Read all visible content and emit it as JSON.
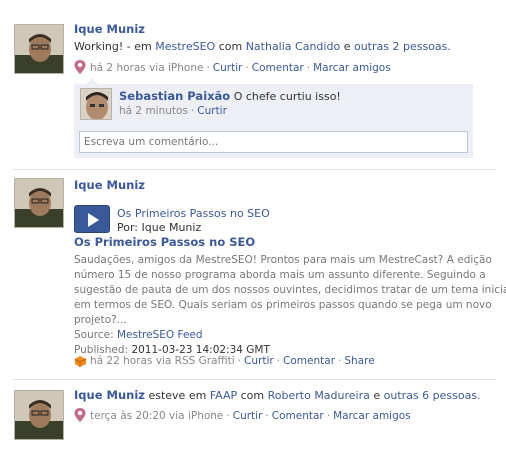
{
  "posts": [
    {
      "author": "Ique Muniz",
      "status_text": "Working!",
      "place_prefix": "- em",
      "place": "MestreSEO",
      "with_prefix": "com",
      "with_person": "Nathalia Candido",
      "and_text": "e",
      "others_link": "outras 2 pessoas.",
      "meta_time": "há 2 horas via iPhone",
      "action_like": "Curtir",
      "action_comment": "Comentar",
      "action_tag": "Marcar amigos",
      "comment": {
        "author": "Sebastian Paixão",
        "text": "O chefe curtiu isso!",
        "time": "há 2 minutos",
        "like": "Curtir"
      },
      "comment_placeholder": "Escreva um comentário..."
    },
    {
      "author": "Ique Muniz",
      "attachment_title": "Os Primeiros Passos no SEO",
      "attachment_by": "Por: Ique Muniz",
      "headline": "Os Primeiros Passos no SEO",
      "description_lines": [
        "Saudações, amigos da MestreSEO! Prontos para mais um MestreCast? A edição",
        "número 15 de nosso programa aborda mais um assunto diferente. Seguindo a",
        "sugestão de pauta de um dos nossos ouvintes, decidimos tratar de um tema inicial",
        "em termos de SEO. Quais seriam os primeiros passos quando se pega um novo",
        "projeto?..."
      ],
      "source_label": "Source:",
      "source_link": "MestreSEO Feed",
      "published_label": "Published:",
      "published_value": "2011-03-23 14:02:34 GMT",
      "meta_time": "há 22 horas via RSS Graffiti",
      "action_like": "Curtir",
      "action_comment": "Comentar",
      "action_share": "Share"
    },
    {
      "author": "Ique Muniz",
      "text_mid": "esteve em",
      "place": "FAAP",
      "with_prefix": "com",
      "with_person": "Roberto Madureira",
      "and_text": "e",
      "others_link": "outras 6 pessoas.",
      "meta_time": "terça às 20:20 via iPhone",
      "action_like": "Curtir",
      "action_comment": "Comentar",
      "action_tag": "Marcar amigos"
    }
  ],
  "colors": {
    "link": "#3b5998",
    "meta": "#888888",
    "comment_bg": "#edeff4"
  },
  "icons": [
    "avatar",
    "location-pin-icon",
    "play-icon",
    "rss-graffiti-icon"
  ]
}
